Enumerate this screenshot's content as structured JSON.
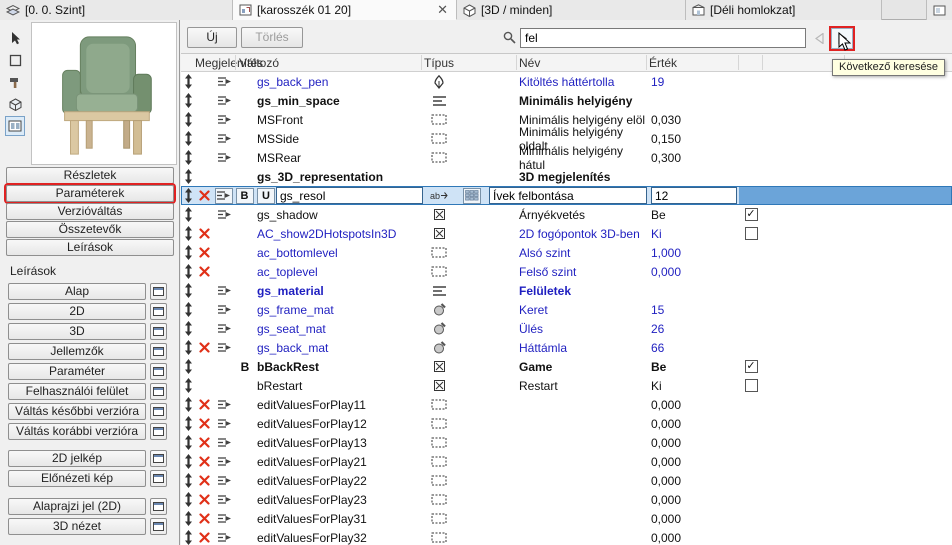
{
  "tabs": [
    {
      "label": "[0. 0. Szint]",
      "icon": "story-icon",
      "active": false,
      "closable": false
    },
    {
      "label": "[karosszék 01 20]",
      "icon": "object-icon",
      "active": true,
      "closable": true
    },
    {
      "label": "[3D / minden]",
      "icon": "cube-icon",
      "active": false,
      "closable": false
    },
    {
      "label": "[Déli homlokzat]",
      "icon": "elevation-icon",
      "active": false,
      "closable": false
    },
    {
      "label": "",
      "icon": "partial-tab-icon",
      "active": false,
      "closable": false
    }
  ],
  "sidebar": {
    "preview_tools": [
      {
        "icon": "arrow-tool-icon",
        "selected": false
      },
      {
        "icon": "frame-tool-icon",
        "selected": false
      },
      {
        "icon": "hammer-tool-icon",
        "selected": false
      },
      {
        "icon": "cube-tool-icon",
        "selected": false
      },
      {
        "icon": "film-tool-icon",
        "selected": true
      }
    ],
    "nav_buttons": [
      {
        "label": "Részletek",
        "annotated": false
      },
      {
        "label": "Paraméterek",
        "annotated": true
      },
      {
        "label": "Verzióváltás",
        "annotated": false
      },
      {
        "label": "Összetevők",
        "annotated": false
      },
      {
        "label": "Leírások",
        "annotated": false
      }
    ],
    "group_label": "Leírások",
    "script_buttons": [
      "Alap",
      "2D",
      "3D",
      "Jellemzők",
      "Paraméter",
      "Felhasználói felület",
      "Váltás későbbi verzióra",
      "Váltás korábbi verzióra"
    ],
    "picture_buttons": [
      "2D jelkép",
      "Előnézeti kép"
    ],
    "symbol_buttons": [
      "Alaprajzi jel (2D)",
      "3D nézet"
    ]
  },
  "toolbar": {
    "new_label": "Új",
    "delete_label": "Törlés",
    "search_value": "fel",
    "tooltip": "Következő keresése"
  },
  "table": {
    "headers": [
      "Megjelenítés",
      "Változó",
      "Típus",
      "Név",
      "Érték"
    ],
    "selected_controls": {
      "bold": "B",
      "unique": "U"
    },
    "rows": [
      {
        "variable": "gs_back_pen",
        "blue": true,
        "display": true,
        "type": "pen",
        "name": "Kitöltés háttértolla",
        "value": "19"
      },
      {
        "variable": "gs_min_space",
        "bold": true,
        "display": true,
        "type": "title",
        "name": "Minimális helyigény",
        "value": ""
      },
      {
        "variable": "MSFront",
        "display": true,
        "type": "dim",
        "name": "Minimális helyigény elöl",
        "value": "0,030"
      },
      {
        "variable": "MSSide",
        "display": true,
        "type": "dim",
        "name": "Minimális helyigény oldalt",
        "value": "0,150"
      },
      {
        "variable": "MSRear",
        "display": true,
        "type": "dim",
        "name": "Minimális helyigény hátul",
        "value": "0,300"
      },
      {
        "variable": "gs_3D_representation",
        "bold": true,
        "name": "3D megjelenítés",
        "value": ""
      },
      {
        "variable": "gs_resol",
        "selected": true,
        "x": true,
        "display": true,
        "type": "abc",
        "array": true,
        "name": "Ívek felbontása",
        "value": "12"
      },
      {
        "variable": "gs_shadow",
        "display": true,
        "type": "check",
        "name": "Árnyékvetés",
        "value": "Be",
        "checkbox": "checked"
      },
      {
        "variable": "AC_show2DHotspotsIn3D",
        "blue": true,
        "x": true,
        "type": "check",
        "name": "2D fogópontok 3D-ben",
        "value": "Ki",
        "checkbox": "unchecked"
      },
      {
        "variable": "ac_bottomlevel",
        "blue": true,
        "x": true,
        "type": "dim",
        "name": "Alsó szint",
        "value": "1,000"
      },
      {
        "variable": "ac_toplevel",
        "blue": true,
        "x": true,
        "type": "dim",
        "name": "Felső szint",
        "value": "0,000"
      },
      {
        "variable": "gs_material",
        "blue": true,
        "bold": true,
        "display": true,
        "type": "title",
        "name": "Felületek",
        "value": ""
      },
      {
        "variable": "gs_frame_mat",
        "blue": true,
        "display": true,
        "type": "material",
        "name": "Keret",
        "value": "15"
      },
      {
        "variable": "gs_seat_mat",
        "blue": true,
        "display": true,
        "type": "material",
        "name": "Ülés",
        "value": "26"
      },
      {
        "variable": "gs_back_mat",
        "blue": true,
        "x": true,
        "display": true,
        "type": "material",
        "name": "Háttámla",
        "value": "66"
      },
      {
        "variable": "bBackRest",
        "bold": true,
        "bflag": "B",
        "type": "check",
        "name": "Game",
        "value": "Be",
        "checkbox": "checked"
      },
      {
        "variable": "bRestart",
        "type": "check",
        "name": "Restart",
        "value": "Ki",
        "checkbox": "unchecked"
      },
      {
        "variable": "editValuesForPlay11",
        "x": true,
        "display": true,
        "type": "dim",
        "name": "",
        "value": "0,000"
      },
      {
        "variable": "editValuesForPlay12",
        "x": true,
        "display": true,
        "type": "dim",
        "name": "",
        "value": "0,000"
      },
      {
        "variable": "editValuesForPlay13",
        "x": true,
        "display": true,
        "type": "dim",
        "name": "",
        "value": "0,000"
      },
      {
        "variable": "editValuesForPlay21",
        "x": true,
        "display": true,
        "type": "dim",
        "name": "",
        "value": "0,000"
      },
      {
        "variable": "editValuesForPlay22",
        "x": true,
        "display": true,
        "type": "dim",
        "name": "",
        "value": "0,000"
      },
      {
        "variable": "editValuesForPlay23",
        "x": true,
        "display": true,
        "type": "dim",
        "name": "",
        "value": "0,000"
      },
      {
        "variable": "editValuesForPlay31",
        "x": true,
        "display": true,
        "type": "dim",
        "name": "",
        "value": "0,000"
      },
      {
        "variable": "editValuesForPlay32",
        "x": true,
        "display": true,
        "type": "dim",
        "name": "",
        "value": "0,000"
      }
    ]
  },
  "colors": {
    "param_blue": "#1f1fc0",
    "delete_red": "#e03018",
    "annotation_red": "#e02222",
    "selection_fill": "#cfe3f6",
    "selection_dark": "#6ba4d9",
    "tooltip_bg": "#ffffe1"
  }
}
